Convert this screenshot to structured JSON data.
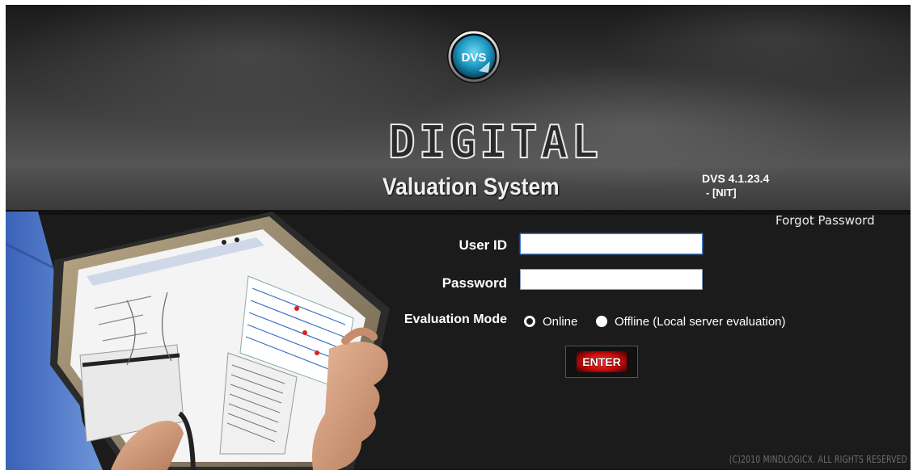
{
  "header": {
    "logo_text": "DVS",
    "title_line1": "DIGITAL",
    "title_line2": "Valuation System",
    "version_line1": "DVS 4.1.23.4",
    "version_line2": "- [NIT]"
  },
  "login": {
    "forgot_password": "Forgot Password",
    "user_id_label": "User ID",
    "user_id_value": "",
    "password_label": "Password",
    "password_value": "",
    "evaluation_mode_label": "Evaluation Mode",
    "mode_options": [
      {
        "label": "Online",
        "selected": true
      },
      {
        "label": "Offline (Local server evaluation)",
        "selected": false
      }
    ],
    "enter_label": "ENTER"
  },
  "footer": {
    "copyright": "(C)2010 MINDLOGICX. ALL RIGHTS RESERVED"
  },
  "colors": {
    "background": "#1b1b1b",
    "button_red": "#c80a0a",
    "logo_teal": "#1ea3c8",
    "copyright_gray": "#6e6e6e"
  },
  "icons": [
    "dvs-logo-icon",
    "tablet-illustration"
  ]
}
